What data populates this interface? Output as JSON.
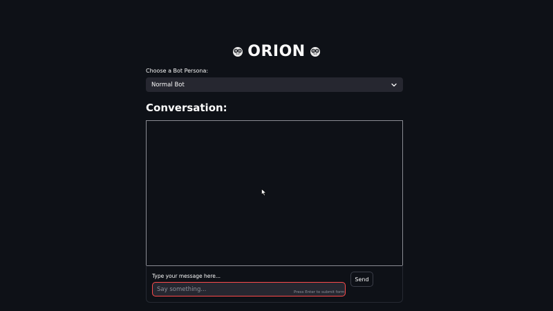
{
  "app": {
    "title": "ORION",
    "title_icon": "nerd-face-icon"
  },
  "persona": {
    "label": "Choose a Bot Persona:",
    "selected": "Normal Bot"
  },
  "conversation": {
    "heading": "Conversation:",
    "messages": []
  },
  "message_form": {
    "label": "Type your message here...",
    "placeholder": "Say something...",
    "value": "",
    "hint": "Press Enter to submit form",
    "send_label": "Send"
  },
  "colors": {
    "background": "#0e1117",
    "input_bg": "#262730",
    "input_focus_border": "#ff4b4b",
    "text": "#fafafa",
    "muted": "#8e9099"
  }
}
